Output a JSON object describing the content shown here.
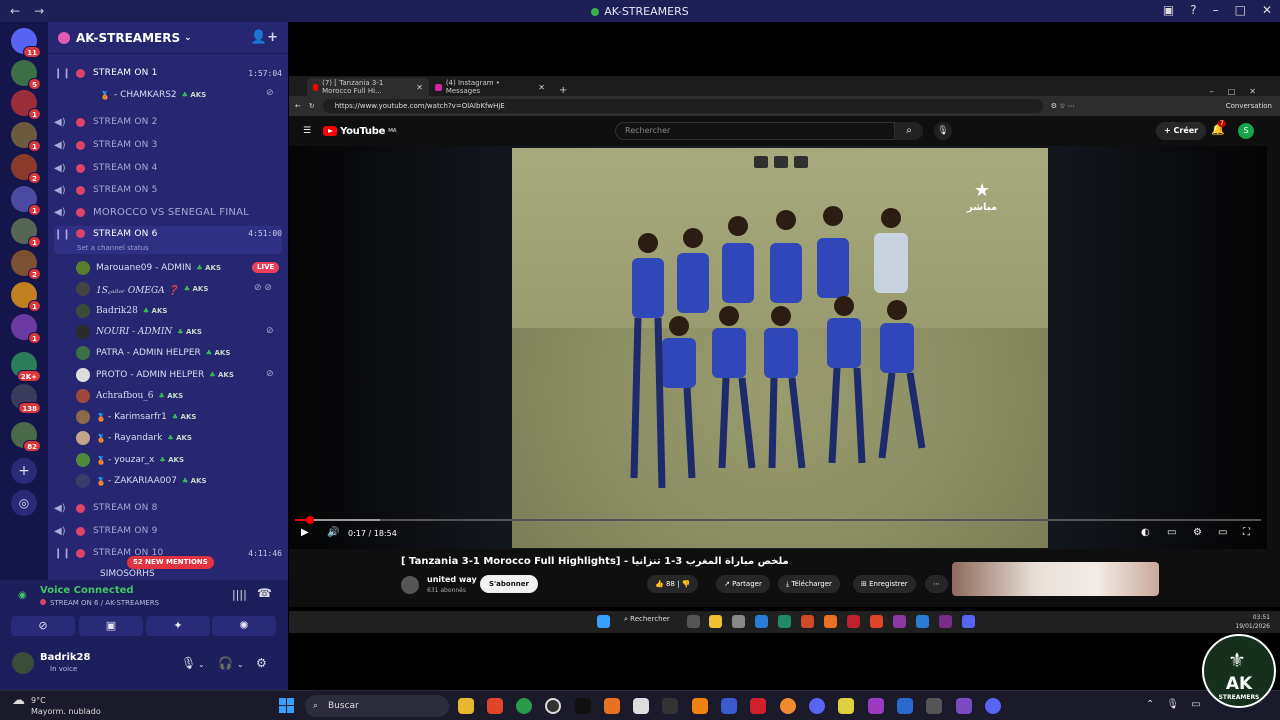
{
  "window": {
    "title": "AK-STREAMERS"
  },
  "guild": {
    "name": "AK-STREAMERS"
  },
  "servers": [
    {
      "badge": "11"
    },
    {
      "badge": "5"
    },
    {
      "badge": "1"
    },
    {
      "badge": "1"
    },
    {
      "badge": "2"
    },
    {
      "badge": "1"
    },
    {
      "badge": "1"
    },
    {
      "badge": "2"
    },
    {
      "badge": "1"
    },
    {
      "badge": "1"
    },
    {
      "badge": "2K+"
    },
    {
      "badge": "138"
    },
    {
      "badge": "82"
    }
  ],
  "channels": {
    "stream1": {
      "name": "STREAM ON 1",
      "time": "1:57:04"
    },
    "stream1_user": {
      "name": "- CHAMKARS2",
      "tag": "AKS"
    },
    "stream2": {
      "name": "STREAM ON 2"
    },
    "stream3": {
      "name": "STREAM ON 3"
    },
    "stream4": {
      "name": "STREAM ON 4"
    },
    "stream5": {
      "name": "STREAM ON 5"
    },
    "final": {
      "name": "MOROCCO VS SENEGAL FINAL"
    },
    "stream6": {
      "name": "STREAM ON 6",
      "time": "4:51:00",
      "status_hint": "Set a channel status"
    },
    "stream8": {
      "name": "STREAM ON 8"
    },
    "stream9": {
      "name": "STREAM ON 9"
    },
    "stream10": {
      "name": "STREAM ON 10",
      "time": "4:11:46"
    },
    "stream10_user": {
      "name": "SIMOSORHS"
    }
  },
  "stream6_users": [
    {
      "name": "Marouane09 - ADMIN",
      "tag": "AKS",
      "color": "#5a7d2e"
    },
    {
      "name": "1S꜀ₐᵢₗₒᵣ OMEGA ❓",
      "tag": "AKS",
      "color": "#444"
    },
    {
      "name": "Badrik28",
      "tag": "AKS",
      "color": "#3b4d3a"
    },
    {
      "name": "NOURI - ADMIN",
      "tag": "AKS",
      "color": "#2b2b2b"
    },
    {
      "name": "PATRA - ADMIN HELPER",
      "tag": "AKS",
      "color": "#3c6e47"
    },
    {
      "name": "PROTO - ADMIN HELPER",
      "tag": "AKS",
      "color": "#ddd"
    },
    {
      "name": "Achrafbou_6",
      "tag": "AKS",
      "color": "#a0483a"
    },
    {
      "name": "- Karimsarfr1",
      "tag": "AKS",
      "color": "#8a6a4a"
    },
    {
      "name": "- Rayandark",
      "tag": "AKS",
      "color": "#c2a58a"
    },
    {
      "name": "- youzar_x",
      "tag": "AKS",
      "color": "#4f8a3a"
    },
    {
      "name": "- ZAKARIAA007",
      "tag": "AKS",
      "color": "#3c3c6a"
    }
  ],
  "live_badge": "LIVE",
  "mentions": "52 NEW MENTIONS",
  "voice": {
    "title": "Voice Connected",
    "subtitle": "STREAM ON 6 / AK-STREAMERS",
    "user": "Badrik28",
    "status": "In voice"
  },
  "browser": {
    "tabs": [
      {
        "label": "(7) [ Tanzania 3-1 Morocco Full Hi..."
      },
      {
        "label": "(4) Instagram • Messages"
      }
    ],
    "url": "https://www.youtube.com/watch?v=OlAIbKfwHjE",
    "conversation": "Conversation"
  },
  "youtube": {
    "brand": "YouTube",
    "region": "MA",
    "search_placeholder": "Rechercher",
    "create": "Créer",
    "notif_count": "7",
    "avatar": "S",
    "time": "0:17 / 18:54",
    "progress_fraction": 0.016,
    "video_title": "[ Tanzania 3-1 Morocco Full Highlights] - ملخص مباراة المغرب 3-1 تنزانيا",
    "channel": "united way",
    "subs": "631 abonnés",
    "subscribe": "S'abonner",
    "likes": "88",
    "share": "Partager",
    "download": "Télécharger",
    "save": "Enregistrer",
    "channel_watermark": "مباشر"
  },
  "inner_taskbar": {
    "search": "Rechercher",
    "time": "03:51",
    "date": "19/01/2026"
  },
  "taskbar": {
    "weather_temp": "9°C",
    "weather_desc": "Mayorm. nublado",
    "search": "Buscar"
  },
  "watermark": {
    "big": "AK",
    "small": "STREAMERS"
  }
}
